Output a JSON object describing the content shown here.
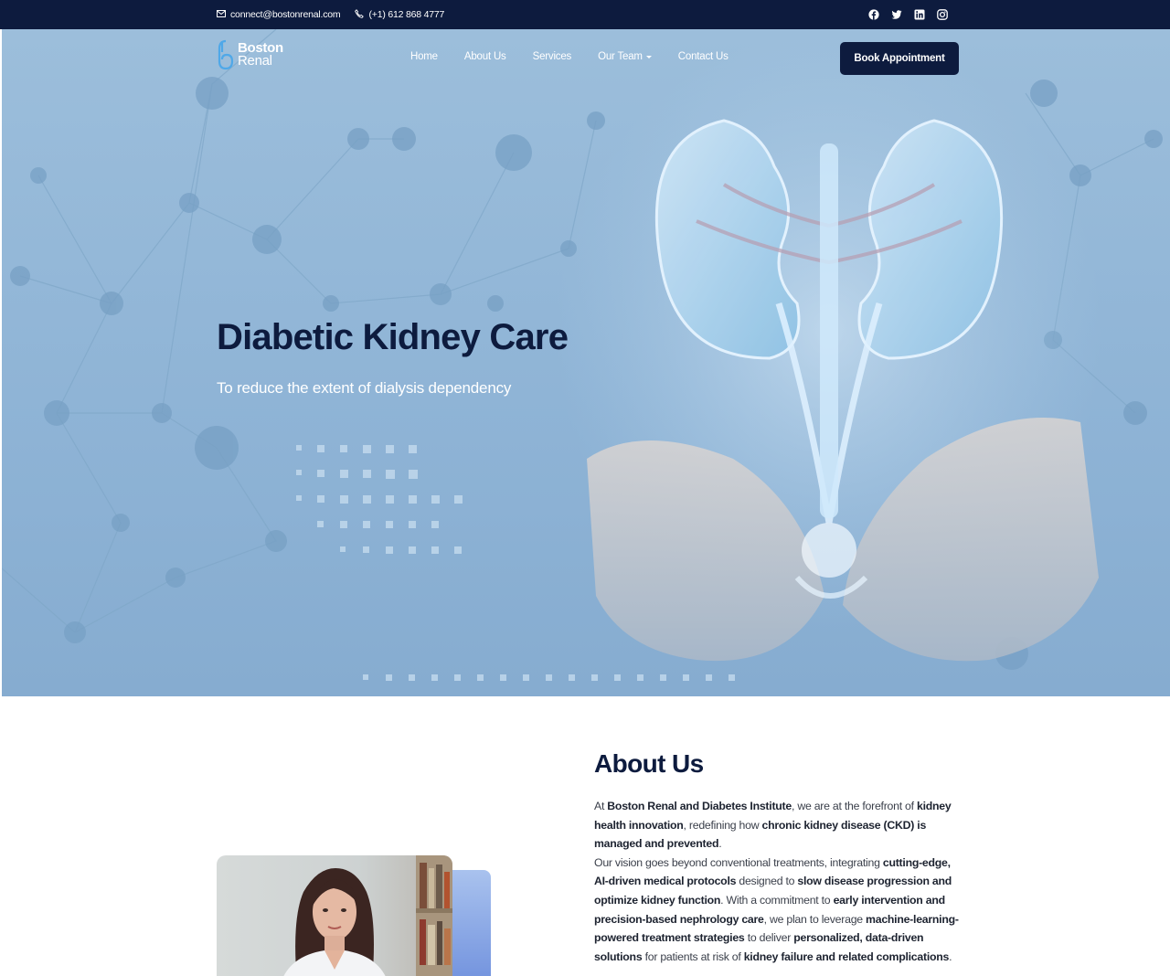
{
  "topbar": {
    "email": "connect@bostonrenal.com",
    "phone": "(+1) 612 868 4777",
    "social": [
      "facebook-icon",
      "twitter-icon",
      "linkedin-icon",
      "instagram-icon"
    ]
  },
  "logo": {
    "line1": "Boston",
    "line2": "Renal"
  },
  "nav": {
    "items": [
      "Home",
      "About Us",
      "Services",
      "Our Team",
      "Contact Us"
    ],
    "cta": "Book Appointment"
  },
  "hero": {
    "title": "Diabetic Kidney Care",
    "subtitle": "To reduce the extent of dialysis dependency"
  },
  "about": {
    "title": "About Us",
    "p1": {
      "t1": "At ",
      "b1": "Boston Renal and Diabetes Institute",
      "t2": ", we are at the forefront of ",
      "b2": "kidney health innovation",
      "t3": ", redefining how ",
      "b3": "chronic kidney disease (CKD) is managed and prevented",
      "t4": "."
    },
    "p2": {
      "t1": "Our vision goes beyond conventional treatments, integrating ",
      "b1": "cutting-edge, AI-driven medical protocols",
      "t2": " designed to ",
      "b2": "slow disease progression and optimize kidney function",
      "t3": ". With a commitment to ",
      "b3": "early intervention and precision-based nephrology care",
      "t4": ", we plan to leverage ",
      "b4": "machine-learning-powered treatment strategies",
      "t5": " to deliver ",
      "b5": "personalized, data-driven solutions",
      "t6": " for patients at risk of ",
      "b6": "kidney failure and related complications",
      "t7": "."
    }
  },
  "colors": {
    "navy": "#0d1b3e",
    "hero_blue": "#93b7d8",
    "accent": "#6f90dd"
  }
}
